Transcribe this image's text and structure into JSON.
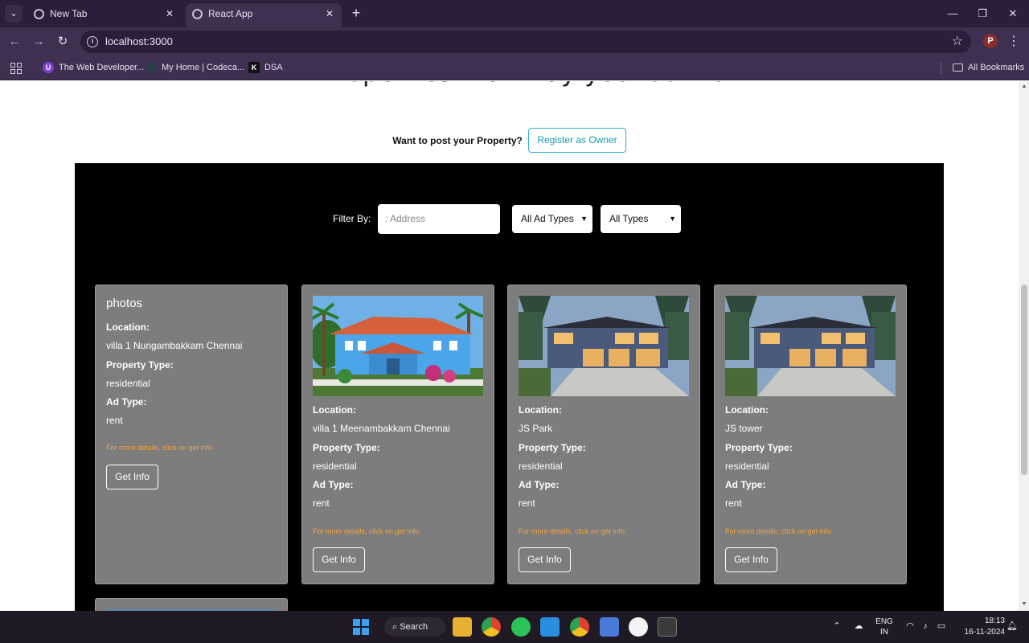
{
  "browser": {
    "tabs": [
      {
        "label": "New Tab",
        "active": false
      },
      {
        "label": "React App",
        "active": true
      }
    ],
    "url": "localhost:3000",
    "bookmarks": [
      "The Web Developer...",
      "My Home | Codeca...",
      "DSA"
    ],
    "all_bookmarks": "All Bookmarks",
    "profile_initial": "P"
  },
  "page": {
    "title": "All Properties that may you look for",
    "post_prompt": "Want to post your Property?",
    "register_button": "Register as Owner",
    "filter": {
      "label": "Filter By:",
      "address_placeholder": ": Address",
      "ad_type_selected": "All Ad Types",
      "property_type_selected": "All Types"
    },
    "cards": [
      {
        "image_alt": "photos",
        "image": "broken",
        "location_label": "Location:",
        "location": "villa 1 Nungambakkam Chennai",
        "ptype_label": "Property Type:",
        "ptype": "residential",
        "ad_label": "Ad Type:",
        "ad": "rent",
        "hint": "For more details, click on get info",
        "button": "Get Info"
      },
      {
        "image": "blue-villa",
        "location_label": "Location:",
        "location": "villa 1 Meenambakkam Chennai",
        "ptype_label": "Property Type:",
        "ptype": "residential",
        "ad_label": "Ad Type:",
        "ad": "rent",
        "hint": "For more details, click on get info",
        "button": "Get Info"
      },
      {
        "image": "modern-house",
        "location_label": "Location:",
        "location": "JS Park",
        "ptype_label": "Property Type:",
        "ptype": "residential",
        "ad_label": "Ad Type:",
        "ad": "rent",
        "hint": "For more details, click on get info",
        "button": "Get Info"
      },
      {
        "image": "modern-house",
        "location_label": "Location:",
        "location": "JS tower",
        "ptype_label": "Property Type:",
        "ptype": "residential",
        "ad_label": "Ad Type:",
        "ad": "rent",
        "hint": "For more details, click on get info",
        "button": "Get Info"
      }
    ]
  },
  "taskbar": {
    "search": "Search",
    "lang_top": "ENG",
    "lang_bottom": "IN",
    "time": "18:13",
    "date": "16-11-2024"
  },
  "colors": {
    "register_border": "#2bb3c9",
    "card_bg": "#7d7d7d",
    "hint": "#f2a23a",
    "panel": "#000000"
  }
}
